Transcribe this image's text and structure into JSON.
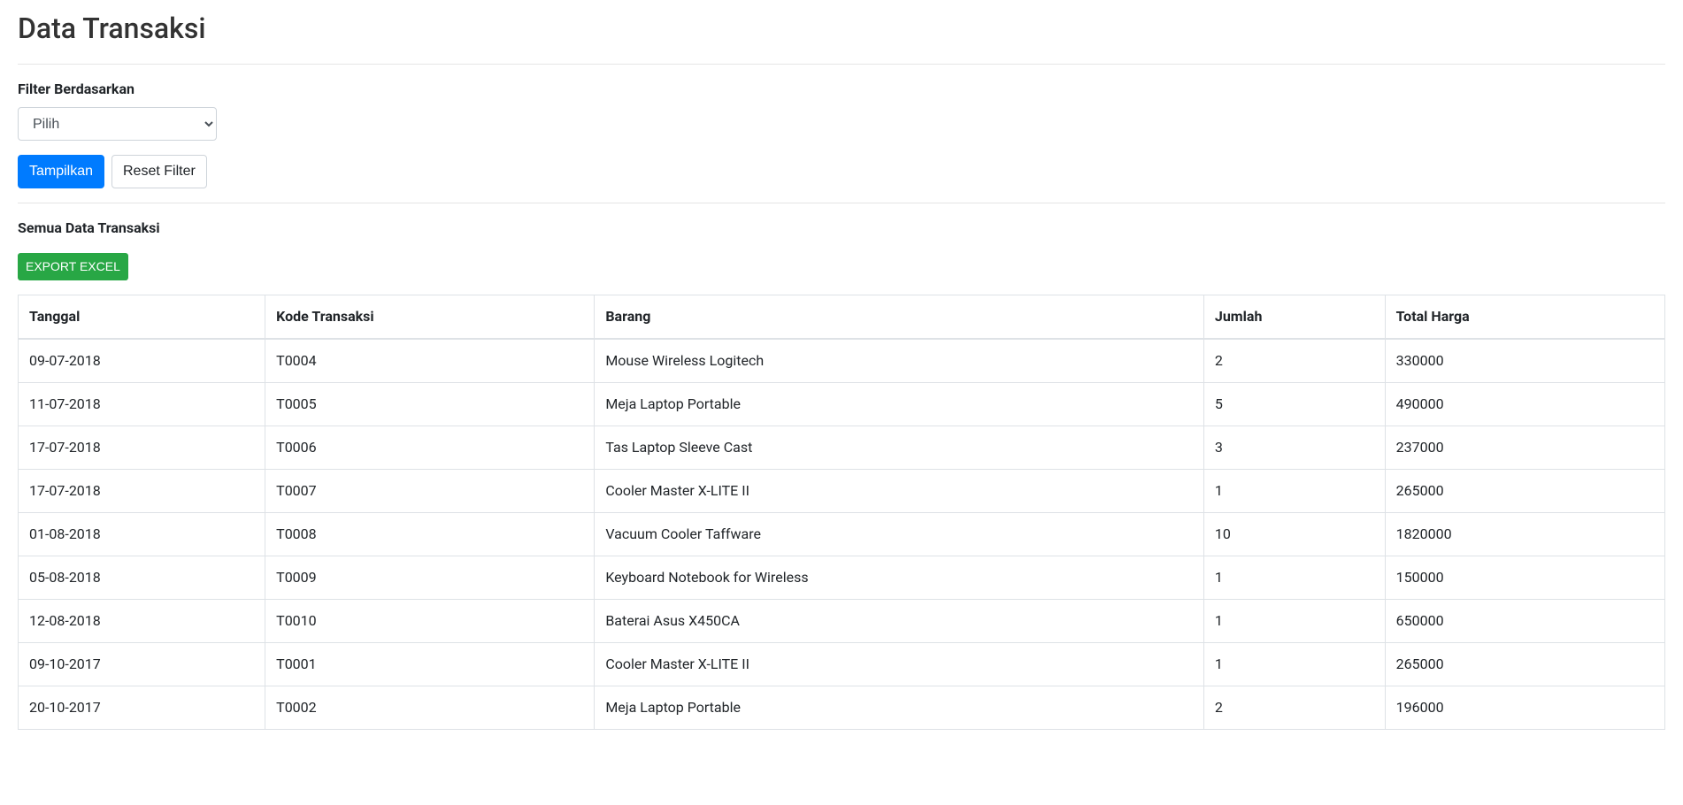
{
  "page": {
    "title": "Data Transaksi"
  },
  "filter": {
    "label": "Filter Berdasarkan",
    "selected": "Pilih",
    "show_button": "Tampilkan",
    "reset_button": "Reset Filter"
  },
  "section": {
    "heading": "Semua Data Transaksi",
    "export_label": "EXPORT EXCEL"
  },
  "table": {
    "headers": {
      "tanggal": "Tanggal",
      "kode": "Kode Transaksi",
      "barang": "Barang",
      "jumlah": "Jumlah",
      "total": "Total Harga"
    },
    "rows": [
      {
        "tanggal": "09-07-2018",
        "kode": "T0004",
        "barang": "Mouse Wireless Logitech",
        "jumlah": "2",
        "total": "330000"
      },
      {
        "tanggal": "11-07-2018",
        "kode": "T0005",
        "barang": "Meja Laptop Portable",
        "jumlah": "5",
        "total": "490000"
      },
      {
        "tanggal": "17-07-2018",
        "kode": "T0006",
        "barang": "Tas Laptop Sleeve Cast",
        "jumlah": "3",
        "total": "237000"
      },
      {
        "tanggal": "17-07-2018",
        "kode": "T0007",
        "barang": "Cooler Master X-LITE II",
        "jumlah": "1",
        "total": "265000"
      },
      {
        "tanggal": "01-08-2018",
        "kode": "T0008",
        "barang": "Vacuum Cooler Taffware",
        "jumlah": "10",
        "total": "1820000"
      },
      {
        "tanggal": "05-08-2018",
        "kode": "T0009",
        "barang": "Keyboard Notebook for Wireless",
        "jumlah": "1",
        "total": "150000"
      },
      {
        "tanggal": "12-08-2018",
        "kode": "T0010",
        "barang": "Baterai Asus X450CA",
        "jumlah": "1",
        "total": "650000"
      },
      {
        "tanggal": "09-10-2017",
        "kode": "T0001",
        "barang": "Cooler Master X-LITE II",
        "jumlah": "1",
        "total": "265000"
      },
      {
        "tanggal": "20-10-2017",
        "kode": "T0002",
        "barang": "Meja Laptop Portable",
        "jumlah": "2",
        "total": "196000"
      }
    ]
  }
}
